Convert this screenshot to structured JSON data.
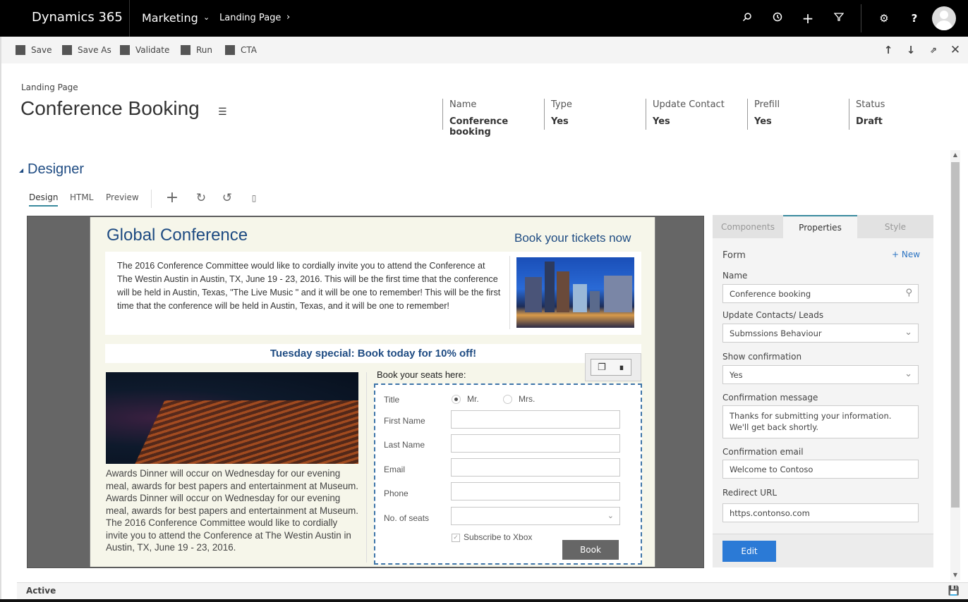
{
  "app": {
    "brand": "Dynamics 365",
    "module": "Marketing",
    "breadcrumb": "Landing Page",
    "top_icons": [
      "search-icon",
      "recent-icon",
      "add-icon",
      "filter-icon",
      "settings-icon",
      "help-icon"
    ]
  },
  "commands": [
    {
      "label": "Save"
    },
    {
      "label": "Save As"
    },
    {
      "label": "Validate"
    },
    {
      "label": "Run"
    },
    {
      "label": "CTA"
    }
  ],
  "record_nav": [
    "previous-record-icon",
    "next-record-icon",
    "open-new-window-icon",
    "close-icon"
  ],
  "entity": {
    "type": "Landing Page",
    "title": "Conference Booking"
  },
  "header_fields": [
    {
      "label": "Name",
      "value": "Conference booking"
    },
    {
      "label": "Type",
      "value": "Yes"
    },
    {
      "label": "Update Contact",
      "value": "Yes"
    },
    {
      "label": "Prefill",
      "value": "Yes"
    },
    {
      "label": "Status",
      "value": "Draft"
    }
  ],
  "designer": {
    "section_title": "Designer",
    "tabs": [
      {
        "label": "Design",
        "active": true
      },
      {
        "label": "HTML",
        "active": false
      },
      {
        "label": "Preview",
        "active": false
      }
    ],
    "tools": [
      "add-icon",
      "redo-icon",
      "undo-icon",
      "device-preview-icon"
    ]
  },
  "landing_page": {
    "title": "Global Conference",
    "cta": "Book your tickets now",
    "intro": "The 2016 Conference Committee would like to cordially invite you to attend the Conference at The Westin Austin in Austin, TX, June 19 - 23, 2016. This will be the first time that the conference will be held in Austin, Texas, \"The Live Music \" and it will be one to remember! This will be the first time that the conference will be held in Austin, Texas, and it will be one to remember!",
    "special": "Tuesday special: Book today for 10% off!",
    "awards": "Awards Dinner will occur on Wednesday for our evening meal, awards for best papers and entertainment at Museum. Awards Dinner will occur on Wednesday for our evening meal, awards for best papers and entertainment at Museum. The 2016 Conference Committee would like to cordially invite you to attend the Conference at The Westin Austin in Austin, TX, June 19 - 23, 2016.",
    "form": {
      "heading": "Book  your seats here:",
      "title_label": "Title",
      "title_options": [
        {
          "label": "Mr.",
          "selected": true
        },
        {
          "label": "Mrs.",
          "selected": false
        }
      ],
      "fields": [
        {
          "label": "First Name",
          "value": ""
        },
        {
          "label": "Last Name",
          "value": ""
        },
        {
          "label": "Email",
          "value": ""
        },
        {
          "label": "Phone",
          "value": ""
        },
        {
          "label": "No. of seats",
          "value": ""
        }
      ],
      "subscribe_label": "Subscribe to Xbox",
      "subscribe_checked": true,
      "submit_label": "Book"
    }
  },
  "properties_panel": {
    "tabs": [
      {
        "label": "Components",
        "active": false
      },
      {
        "label": "Properties",
        "active": true
      },
      {
        "label": "Style",
        "active": false
      }
    ],
    "section": "Form",
    "new_link": "+ New",
    "fields": {
      "name_label": "Name",
      "name_value": "Conference booking",
      "update_label": "Update Contacts/ Leads",
      "update_value": "Submssions Behaviour",
      "show_conf_label": "Show confirmation",
      "show_conf_value": "Yes",
      "conf_msg_label": "Confirmation message",
      "conf_msg_line1": "Thanks for submitting your information.",
      "conf_msg_line2": "We'll get back shortly.",
      "conf_email_label": "Confirmation email",
      "conf_email_value": "Welcome to Contoso",
      "redirect_label": "Redirect URL",
      "redirect_value": "https.contonso.com"
    },
    "edit_label": "Edit"
  },
  "status": {
    "text": "Active"
  },
  "colors": {
    "accent_blue": "#2b7ad6",
    "heading_blue": "#1e4b82",
    "tab_underline": "#3a8a9e"
  }
}
